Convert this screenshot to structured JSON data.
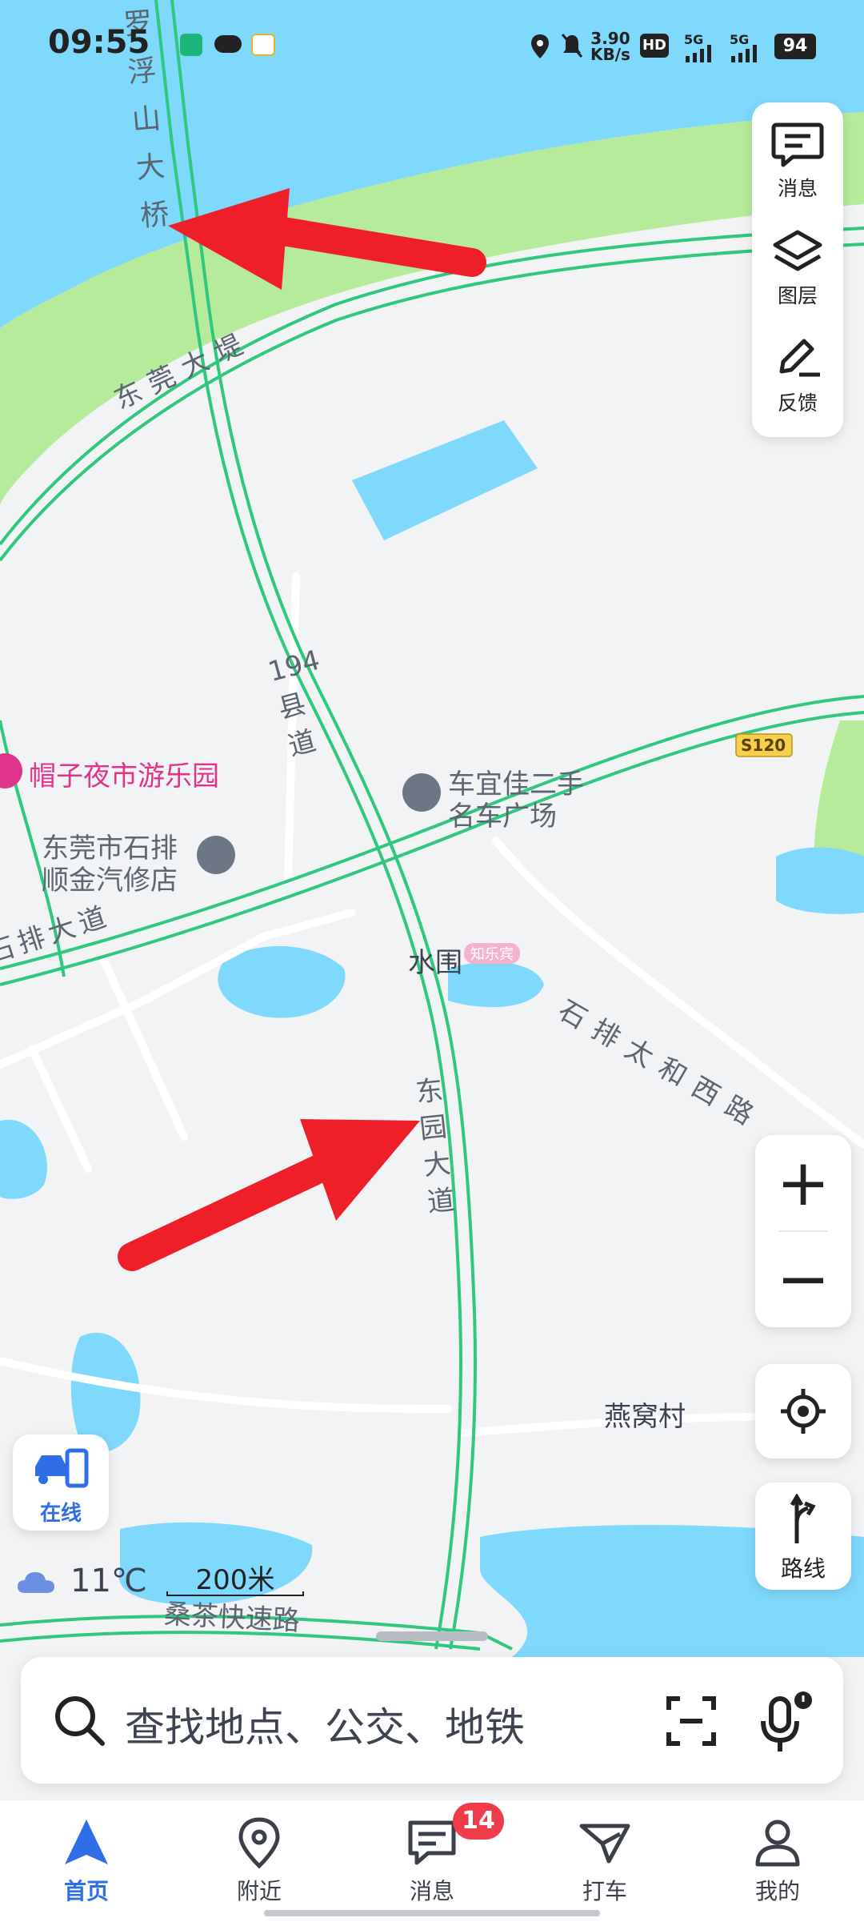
{
  "status_bar": {
    "time": "09:55",
    "speed_value": "3.90",
    "speed_unit": "KB/s",
    "battery": "94",
    "hd_label": "HD",
    "net_1": "5G",
    "net_2": "5G"
  },
  "map_tools": {
    "messages_label": "消息",
    "layers_label": "图层",
    "feedback_label": "反馈"
  },
  "map_labels": {
    "bridge": "罗浮山大桥",
    "dike": "东莞大堤",
    "county_road": "194县道",
    "amusement_park": "帽子夜市游乐园",
    "car_market_line1": "车宜佳二手",
    "car_market_line2": "名车广场",
    "repair_line1": "东莞市石排",
    "repair_line2": "顺金汽修店",
    "road_shipai": "石排大道",
    "road_s120": "S120",
    "road_taihe": "石排太和西路",
    "shuiwei": "水围",
    "zhidong": "知乐宾",
    "dongyuan": "东园大道",
    "village": "燕窝村",
    "sangcha": "桑茶快速路"
  },
  "online_button": {
    "label": "在线"
  },
  "weather": {
    "temperature": "11℃",
    "icon": "cloud-icon"
  },
  "scale": {
    "label": "200米"
  },
  "zoom": {
    "in_label": "+",
    "out_label": "−"
  },
  "route_button": {
    "label": "路线"
  },
  "search": {
    "placeholder": "查找地点、公交、地铁"
  },
  "bottom_nav": {
    "home": "首页",
    "nearby": "附近",
    "messages": "消息",
    "taxi": "打车",
    "mine": "我的",
    "messages_badge": "14"
  },
  "colors": {
    "water": "#7fd9fc",
    "green": "#b5eb9a",
    "road": "#2fc87e",
    "accent": "#2f6ee6",
    "arrow": "#ef1f2a",
    "poi_pink": "#e0338c"
  }
}
